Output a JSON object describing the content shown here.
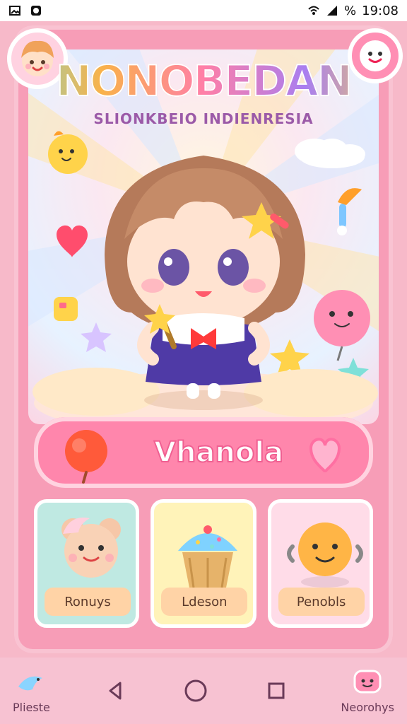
{
  "status_bar": {
    "battery_text": "%",
    "time": "19:08"
  },
  "header": {
    "title": "NONOBEDAN",
    "subtitle": "SLIONKBEIO INDIENRESIA"
  },
  "banner": {
    "label": "Vhanola"
  },
  "cards": [
    {
      "label": "Ronuys",
      "color": "#bfe9e2"
    },
    {
      "label": "Ldeson",
      "color": "#fff3b9"
    },
    {
      "label": "Penobls",
      "color": "#ffdce8"
    }
  ],
  "nav": {
    "left_label": "Plieste",
    "right_label": "Neorohys"
  },
  "colors": {
    "accent_pink": "#ff86ac",
    "frame_pink": "#f79db7",
    "bg_pink": "#f7b9c9"
  },
  "icons": {
    "status_left_1": "gallery-icon",
    "status_left_2": "app-icon",
    "status_right_1": "wifi-icon",
    "status_right_2": "signal-icon",
    "nav_back": "back-icon",
    "nav_home": "home-icon",
    "nav_recent": "recent-apps-icon"
  }
}
